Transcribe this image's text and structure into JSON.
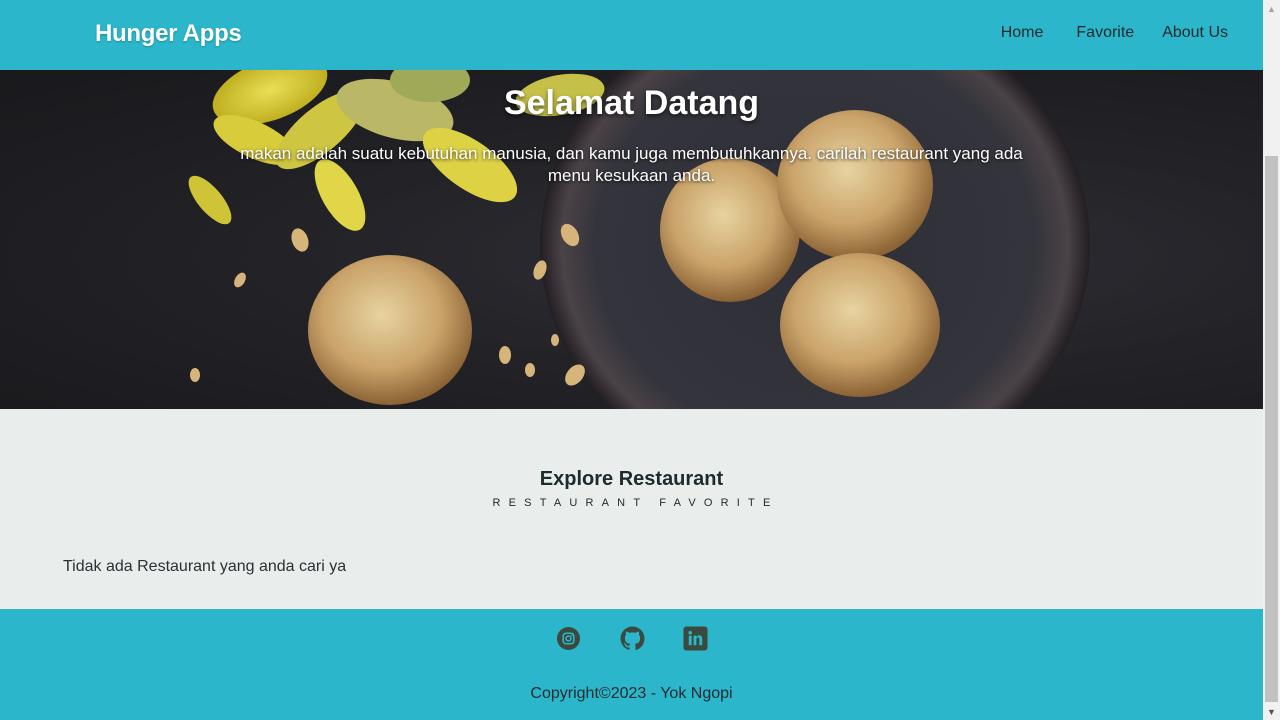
{
  "header": {
    "brand": "Hunger Apps",
    "nav": [
      {
        "label": "Home"
      },
      {
        "label": "Favorite"
      },
      {
        "label": "About Us"
      }
    ]
  },
  "hero": {
    "title": "Selamat Datang",
    "text": "makan adalah suatu kebutuhan manusia, dan kamu juga membutuhkannya. carilah restaurant yang ada menu kesukaan anda."
  },
  "explore": {
    "title": "Explore Restaurant",
    "subtitle": "RESTAURANT FAVORITE",
    "empty_message": "Tidak ada Restaurant yang anda cari ya"
  },
  "footer": {
    "socials": [
      "instagram-icon",
      "github-icon",
      "linkedin-icon"
    ],
    "copyright": "Copyright©2023 - Yok Ngopi"
  },
  "colors": {
    "primary": "#2cb6cb",
    "background": "#e9edec",
    "text": "#1f2a2d",
    "icon": "#3b4a3f"
  }
}
